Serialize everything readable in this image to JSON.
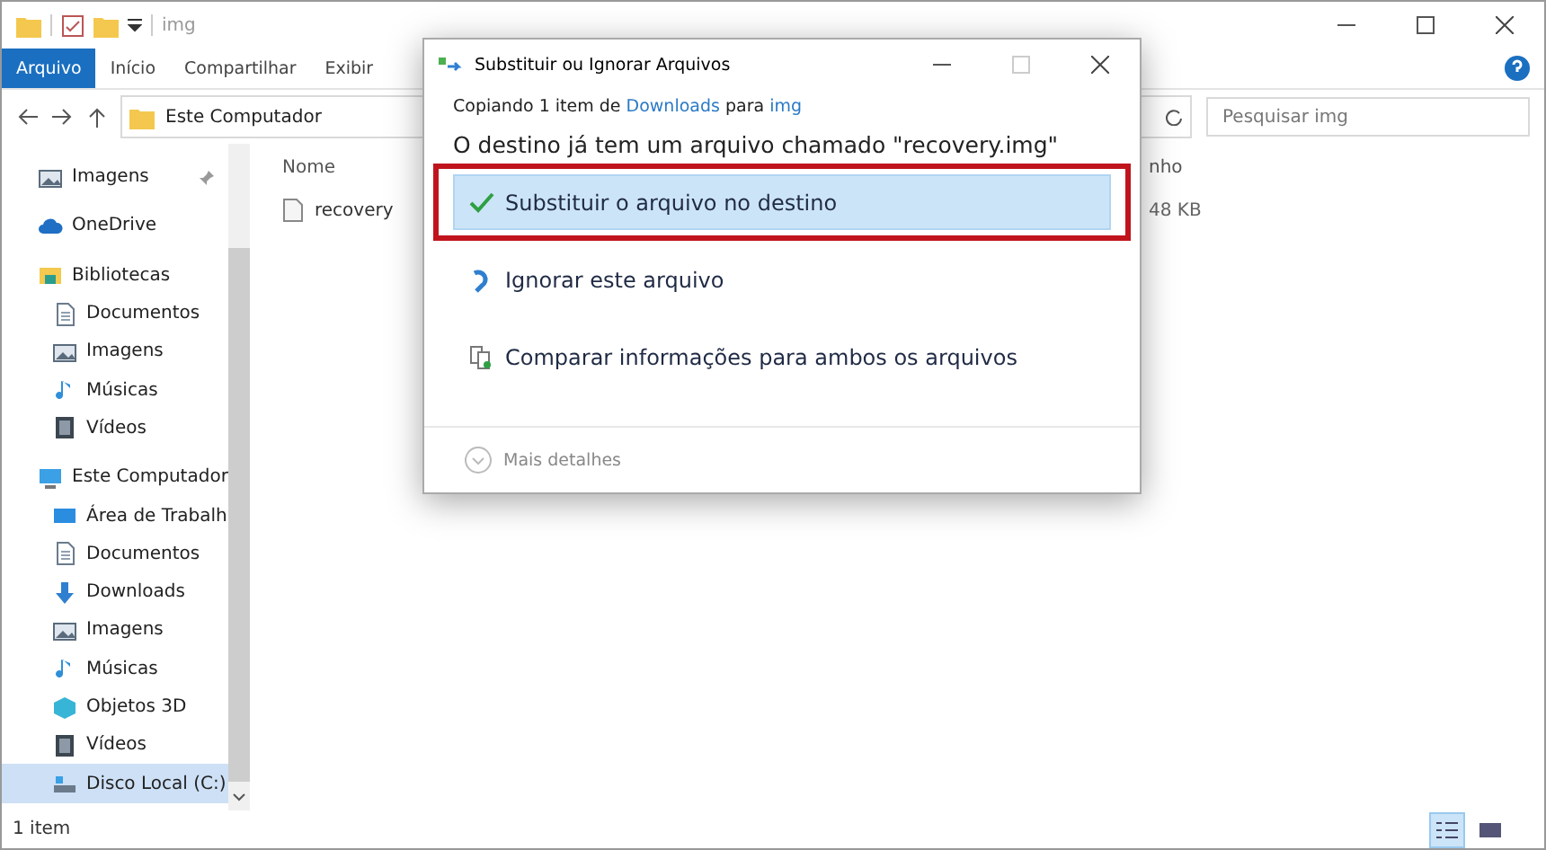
{
  "explorer": {
    "title": "img",
    "ribbon_tabs": [
      {
        "label": "Arquivo",
        "selected": true
      },
      {
        "label": "Início",
        "selected": false
      },
      {
        "label": "Compartilhar",
        "selected": false
      },
      {
        "label": "Exibir",
        "selected": false
      }
    ],
    "breadcrumb": [
      "Este Computador"
    ],
    "search": {
      "placeholder": "Pesquisar img"
    },
    "sidebar": [
      {
        "label": "Imagens",
        "kind": "pictures",
        "selected": false,
        "pinned": true
      },
      {
        "label": "OneDrive",
        "kind": "cloud",
        "selected": false
      },
      {
        "label": "Bibliotecas",
        "kind": "library",
        "selected": false,
        "children": [
          {
            "label": "Documentos",
            "kind": "document",
            "selected": false
          },
          {
            "label": "Imagens",
            "kind": "pictures",
            "selected": false
          },
          {
            "label": "Músicas",
            "kind": "music",
            "selected": false
          },
          {
            "label": "Vídeos",
            "kind": "video",
            "selected": false
          }
        ]
      },
      {
        "label": "Este Computador",
        "kind": "computer",
        "selected": false,
        "children": [
          {
            "label": "Área de Trabalh",
            "kind": "desktop",
            "selected": false
          },
          {
            "label": "Documentos",
            "kind": "document",
            "selected": false
          },
          {
            "label": "Downloads",
            "kind": "download",
            "selected": false
          },
          {
            "label": "Imagens",
            "kind": "pictures",
            "selected": false
          },
          {
            "label": "Músicas",
            "kind": "music",
            "selected": false
          },
          {
            "label": "Objetos 3D",
            "kind": "cube",
            "selected": false
          },
          {
            "label": "Vídeos",
            "kind": "video",
            "selected": false
          },
          {
            "label": "Disco Local (C:)",
            "kind": "drive",
            "selected": true
          }
        ]
      }
    ],
    "columns": [
      "Nome",
      "nho"
    ],
    "files": [
      {
        "name": "recovery",
        "size": "48 KB"
      }
    ],
    "status_bar": "1 item",
    "view_buttons": [
      {
        "kind": "details",
        "selected": true
      },
      {
        "kind": "tiles",
        "selected": false
      }
    ]
  },
  "dialog": {
    "title": "Substituir ou Ignorar Arquivos",
    "copying": {
      "prefix": "Copiando 1 item de",
      "source": "Downloads",
      "middle": "para",
      "dest": "img"
    },
    "heading": "O destino já tem um arquivo chamado \"recovery.img\"",
    "options": [
      {
        "kind": "replace",
        "label": "Substituir o arquivo no destino",
        "selected": true
      },
      {
        "kind": "skip",
        "label": "Ignorar este arquivo",
        "selected": false
      },
      {
        "kind": "compare",
        "label": "Comparar informações para ambos os arquivos",
        "selected": false
      }
    ],
    "details": "Mais detalhes"
  }
}
